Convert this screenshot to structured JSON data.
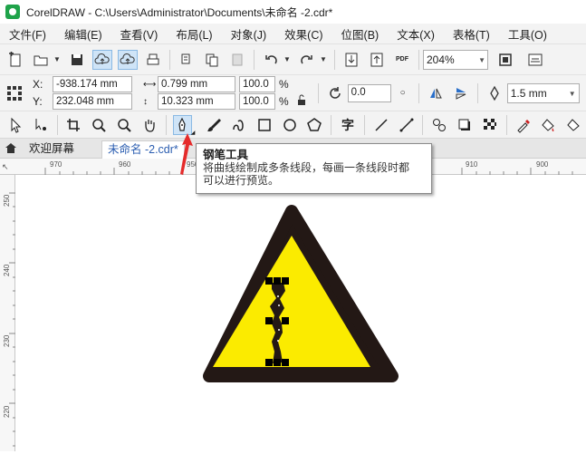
{
  "app": {
    "title": "CorelDRAW - C:\\Users\\Administrator\\Documents\\未命名 -2.cdr*"
  },
  "menu": [
    "文件(F)",
    "编辑(E)",
    "查看(V)",
    "布局(L)",
    "对象(J)",
    "效果(C)",
    "位图(B)",
    "文本(X)",
    "表格(T)",
    "工具(O)"
  ],
  "standard_toolbar": {
    "zoom": "204%",
    "pdf_label": "PDF"
  },
  "property_bar": {
    "x_label": "X:",
    "y_label": "Y:",
    "x": "-938.174 mm",
    "y": "232.048 mm",
    "width": "0.799 mm",
    "height": "10.323 mm",
    "scale_x": "100.0",
    "scale_y": "100.0",
    "pct": "%",
    "rotation": "0.0",
    "outline": "1.5 mm"
  },
  "tabs": {
    "welcome": "欢迎屏幕",
    "document": "未命名 -2.cdr*"
  },
  "ruler": {
    "h": [
      "970",
      "960",
      "950",
      "910",
      "900"
    ],
    "v": [
      "250",
      "240",
      "230",
      "220"
    ]
  },
  "tooltip": {
    "title": "钢笔工具",
    "desc_line1": "将曲线绘制成多条线段，每画一条线段时都",
    "desc_line2": "可以进行预览。"
  },
  "colors": {
    "sign_yellow": "#fbeb00",
    "sign_border": "#231815",
    "accent": "#e52b2b"
  }
}
